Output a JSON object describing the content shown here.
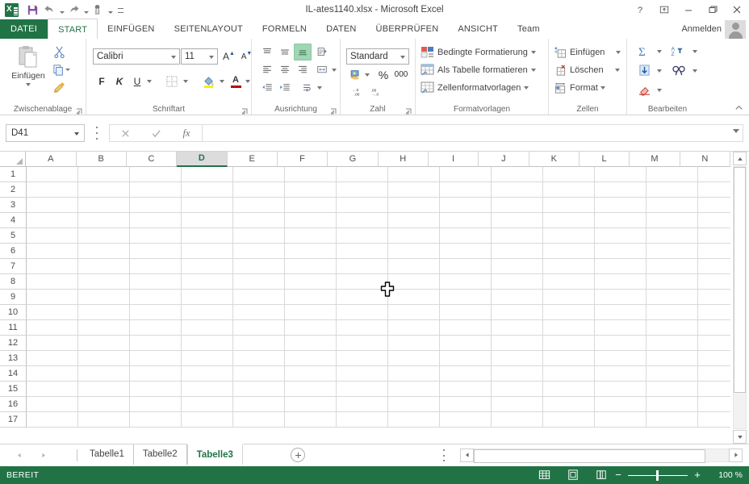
{
  "titlebar": {
    "document_title": "IL-ates1140.xlsx - Microsoft Excel",
    "quick_access": [
      {
        "name": "save-icon",
        "label": "Speichern"
      },
      {
        "name": "undo-icon",
        "label": "Rückgängig"
      },
      {
        "name": "redo-icon",
        "label": "Wiederholen"
      },
      {
        "name": "touch-mode-icon",
        "label": "Fingereingabe-/Mausmodus"
      },
      {
        "name": "customize-qat-icon",
        "label": "Symbolleiste für den Schnellzugriff anpassen"
      }
    ],
    "window_buttons": [
      {
        "name": "help-button",
        "glyph": "?"
      },
      {
        "name": "ribbon-display-options-button",
        "glyph": "⊼"
      },
      {
        "name": "minimize-button",
        "glyph": "—"
      },
      {
        "name": "restore-button",
        "glyph": "❐"
      },
      {
        "name": "close-button",
        "glyph": "✕"
      }
    ]
  },
  "ribbon_tabs": {
    "file_tab": "DATEI",
    "tabs": [
      "START",
      "EINFÜGEN",
      "SEITENLAYOUT",
      "FORMELN",
      "DATEN",
      "ÜBERPRÜFEN",
      "ANSICHT",
      "Team"
    ],
    "active_tab": "START",
    "signin_label": "Anmelden"
  },
  "ribbon": {
    "groups": [
      {
        "name": "clipboard",
        "label": "Zwischenablage"
      },
      {
        "name": "font",
        "label": "Schriftart"
      },
      {
        "name": "alignment",
        "label": "Ausrichtung"
      },
      {
        "name": "number",
        "label": "Zahl"
      },
      {
        "name": "styles",
        "label": "Formatvorlagen"
      },
      {
        "name": "cells",
        "label": "Zellen"
      },
      {
        "name": "editing",
        "label": "Bearbeiten"
      }
    ],
    "clipboard": {
      "paste_label": "Einfügen",
      "cut_label": "Ausschneiden",
      "copy_label": "Kopieren",
      "format_painter_label": "Format übertragen"
    },
    "font": {
      "font_name": "Calibri",
      "font_size": "11",
      "bold_label": "F",
      "italic_label": "K",
      "underline_label": "U",
      "grow_font_label": "A",
      "shrink_font_label": "A",
      "borders_label": "Rahmen",
      "fill_color_label": "Füllfarbe",
      "font_color_label": "Schriftfarbe"
    },
    "number": {
      "format_value": "Standard",
      "percent_label": "%",
      "thousands_label": "000"
    },
    "styles": {
      "conditional_formatting": "Bedingte Formatierung",
      "format_as_table": "Als Tabelle formatieren",
      "cell_styles": "Zellenformatvorlagen"
    },
    "cells": {
      "insert": "Einfügen",
      "delete": "Löschen",
      "format": "Format"
    },
    "editing": {
      "autosum_label": "AutoSumme",
      "fill_label": "Füllbereich",
      "clear_label": "Löschen",
      "sort_filter_label": "Sortieren und Filtern",
      "find_select_label": "Suchen und Auswählen"
    }
  },
  "formula_bar": {
    "name_box_value": "D41",
    "cancel_label": "✕",
    "enter_label": "✓",
    "insert_function_label": "fx",
    "formula_value": ""
  },
  "grid": {
    "columns": [
      "A",
      "B",
      "C",
      "D",
      "E",
      "F",
      "G",
      "H",
      "I",
      "J",
      "K",
      "L",
      "M",
      "N"
    ],
    "selected_column": "D",
    "rows": [
      "1",
      "2",
      "3",
      "4",
      "5",
      "6",
      "7",
      "8",
      "9",
      "10",
      "11",
      "12",
      "13",
      "14",
      "15",
      "16",
      "17"
    ],
    "selected_cell": "D41",
    "cell_values": []
  },
  "sheet_tabs": {
    "tabs": [
      "Tabelle1",
      "Tabelle2",
      "Tabelle3"
    ],
    "active": "Tabelle3",
    "add_sheet_label": "+"
  },
  "status_bar": {
    "status_text": "BEREIT",
    "view_buttons": [
      {
        "name": "normal-view-button",
        "label": "Normal"
      },
      {
        "name": "page-layout-view-button",
        "label": "Seitenlayout"
      },
      {
        "name": "page-break-preview-button",
        "label": "Umbruchvorschau"
      }
    ],
    "zoom_out_label": "−",
    "zoom_in_label": "+",
    "zoom_level": "100 %"
  },
  "colors": {
    "excel_green": "#217346",
    "accent_blue": "#2a5699",
    "selection_green": "#9fd6b4"
  }
}
